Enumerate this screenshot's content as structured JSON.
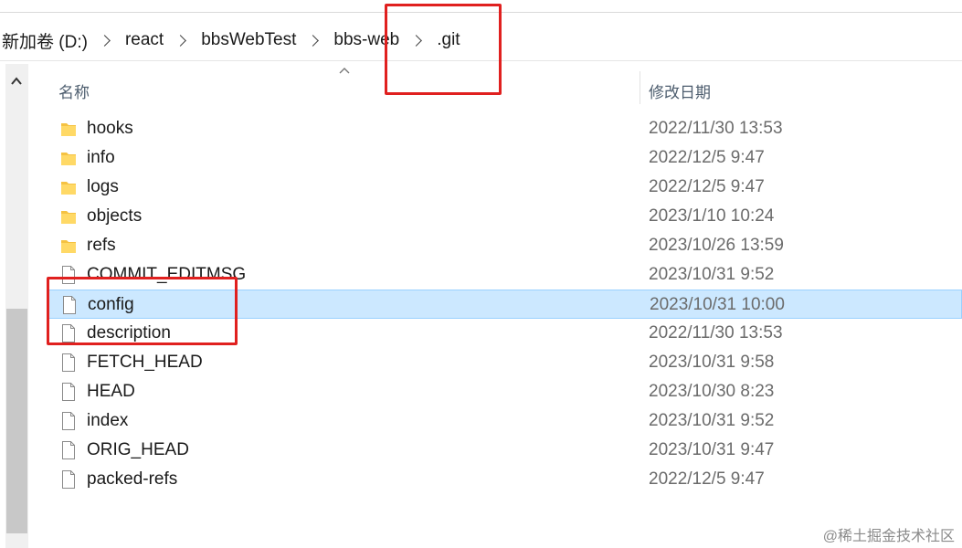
{
  "breadcrumb": [
    "新加卷 (D:)",
    "react",
    "bbsWebTest",
    "bbs-web",
    ".git"
  ],
  "columns": {
    "name": "名称",
    "date_modified": "修改日期"
  },
  "files": [
    {
      "name": "hooks",
      "date": "2022/11/30 13:53",
      "type": "folder"
    },
    {
      "name": "info",
      "date": "2022/12/5 9:47",
      "type": "folder"
    },
    {
      "name": "logs",
      "date": "2022/12/5 9:47",
      "type": "folder"
    },
    {
      "name": "objects",
      "date": "2023/1/10 10:24",
      "type": "folder"
    },
    {
      "name": "refs",
      "date": "2023/10/26 13:59",
      "type": "folder"
    },
    {
      "name": "COMMIT_EDITMSG",
      "date": "2023/10/31 9:52",
      "type": "file"
    },
    {
      "name": "config",
      "date": "2023/10/31 10:00",
      "type": "file",
      "selected": true
    },
    {
      "name": "description",
      "date": "2022/11/30 13:53",
      "type": "file"
    },
    {
      "name": "FETCH_HEAD",
      "date": "2023/10/31 9:58",
      "type": "file"
    },
    {
      "name": "HEAD",
      "date": "2023/10/30 8:23",
      "type": "file"
    },
    {
      "name": "index",
      "date": "2023/10/31 9:52",
      "type": "file"
    },
    {
      "name": "ORIG_HEAD",
      "date": "2023/10/31 9:47",
      "type": "file"
    },
    {
      "name": "packed-refs",
      "date": "2022/12/5 9:47",
      "type": "file"
    }
  ],
  "watermark": "@稀土掘金技术社区",
  "colors": {
    "selection": "#cce8ff",
    "annotation_red": "#e0201f",
    "folder": "#f5c242"
  }
}
